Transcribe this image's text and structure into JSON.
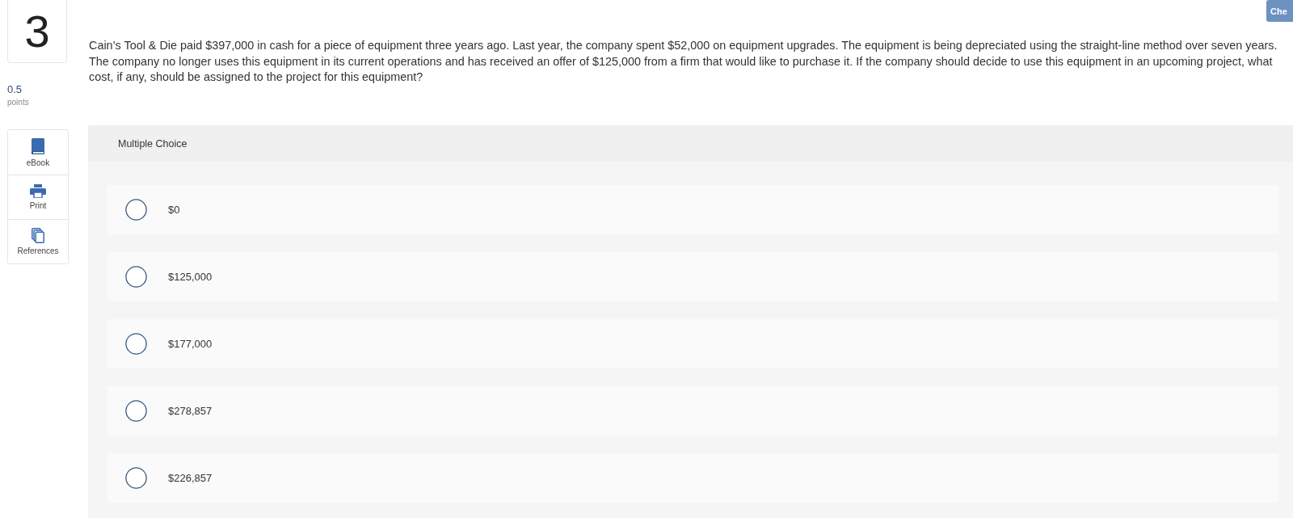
{
  "question": {
    "number": "3",
    "points": "0.5",
    "points_label": "points"
  },
  "tools": [
    {
      "kind": "ebook",
      "label": "eBook"
    },
    {
      "kind": "print",
      "label": "Print"
    },
    {
      "kind": "references",
      "label": "References"
    }
  ],
  "check_button": {
    "label": "Che"
  },
  "prompt": "Cain’s Tool & Die paid $397,000 in cash for a piece of equipment three years ago. Last year, the company spent $52,000 on equipment upgrades. The equipment is being depreciated using the straight-line method over seven years. The company no longer uses this equipment in its current operations and has received an offer of $125,000 from a firm that would like to purchase it. If the company should decide to use this equipment in an upcoming project, what cost, if any, should be assigned to the project for this equipment?",
  "answer_panel": {
    "title": "Multiple Choice",
    "options": [
      {
        "label": "$0",
        "selected": false
      },
      {
        "label": "$125,000",
        "selected": false
      },
      {
        "label": "$177,000",
        "selected": false
      },
      {
        "label": "$278,857",
        "selected": false
      },
      {
        "label": "$226,857",
        "selected": false
      }
    ]
  }
}
